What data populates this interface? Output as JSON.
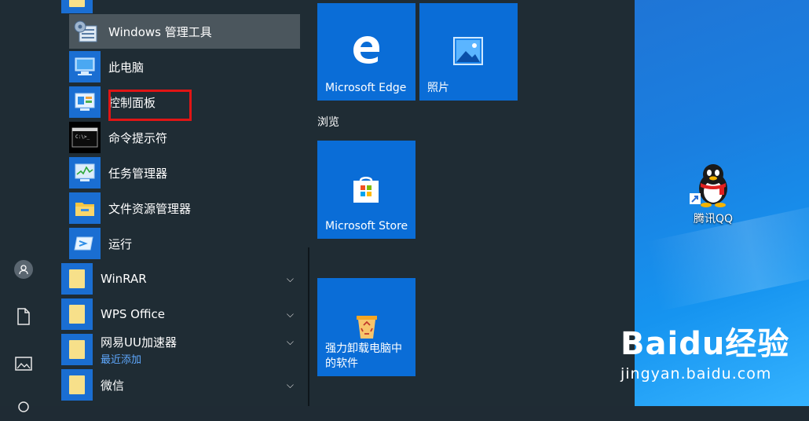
{
  "apps": [
    {
      "label": "Windows 管理工具",
      "icon": "admin-tools-icon"
    },
    {
      "label": "此电脑",
      "icon": "this-pc-icon"
    },
    {
      "label": "控制面板",
      "icon": "control-panel-icon"
    },
    {
      "label": "命令提示符",
      "icon": "cmd-icon"
    },
    {
      "label": "任务管理器",
      "icon": "task-manager-icon"
    },
    {
      "label": "文件资源管理器",
      "icon": "file-explorer-icon"
    },
    {
      "label": "运行",
      "icon": "run-icon"
    }
  ],
  "folders": [
    {
      "label": "WinRAR",
      "sub": ""
    },
    {
      "label": "WPS Office",
      "sub": ""
    },
    {
      "label": "网易UU加速器",
      "sub": "最近添加"
    },
    {
      "label": "微信",
      "sub": ""
    }
  ],
  "tiles": {
    "edge": "Microsoft Edge",
    "photos": "照片",
    "group_browse": "浏览",
    "store": "Microsoft Store",
    "uninstall": "强力卸载电脑中的软件"
  },
  "desktop": {
    "qq_label": "腾讯QQ"
  },
  "watermark": {
    "line1": "Baidu经验",
    "line2": "jingyan.baidu.com"
  },
  "colors": {
    "tile_blue": "#0a6dd7",
    "highlight_red": "#e01515",
    "menu_bg": "#1f2c34"
  }
}
